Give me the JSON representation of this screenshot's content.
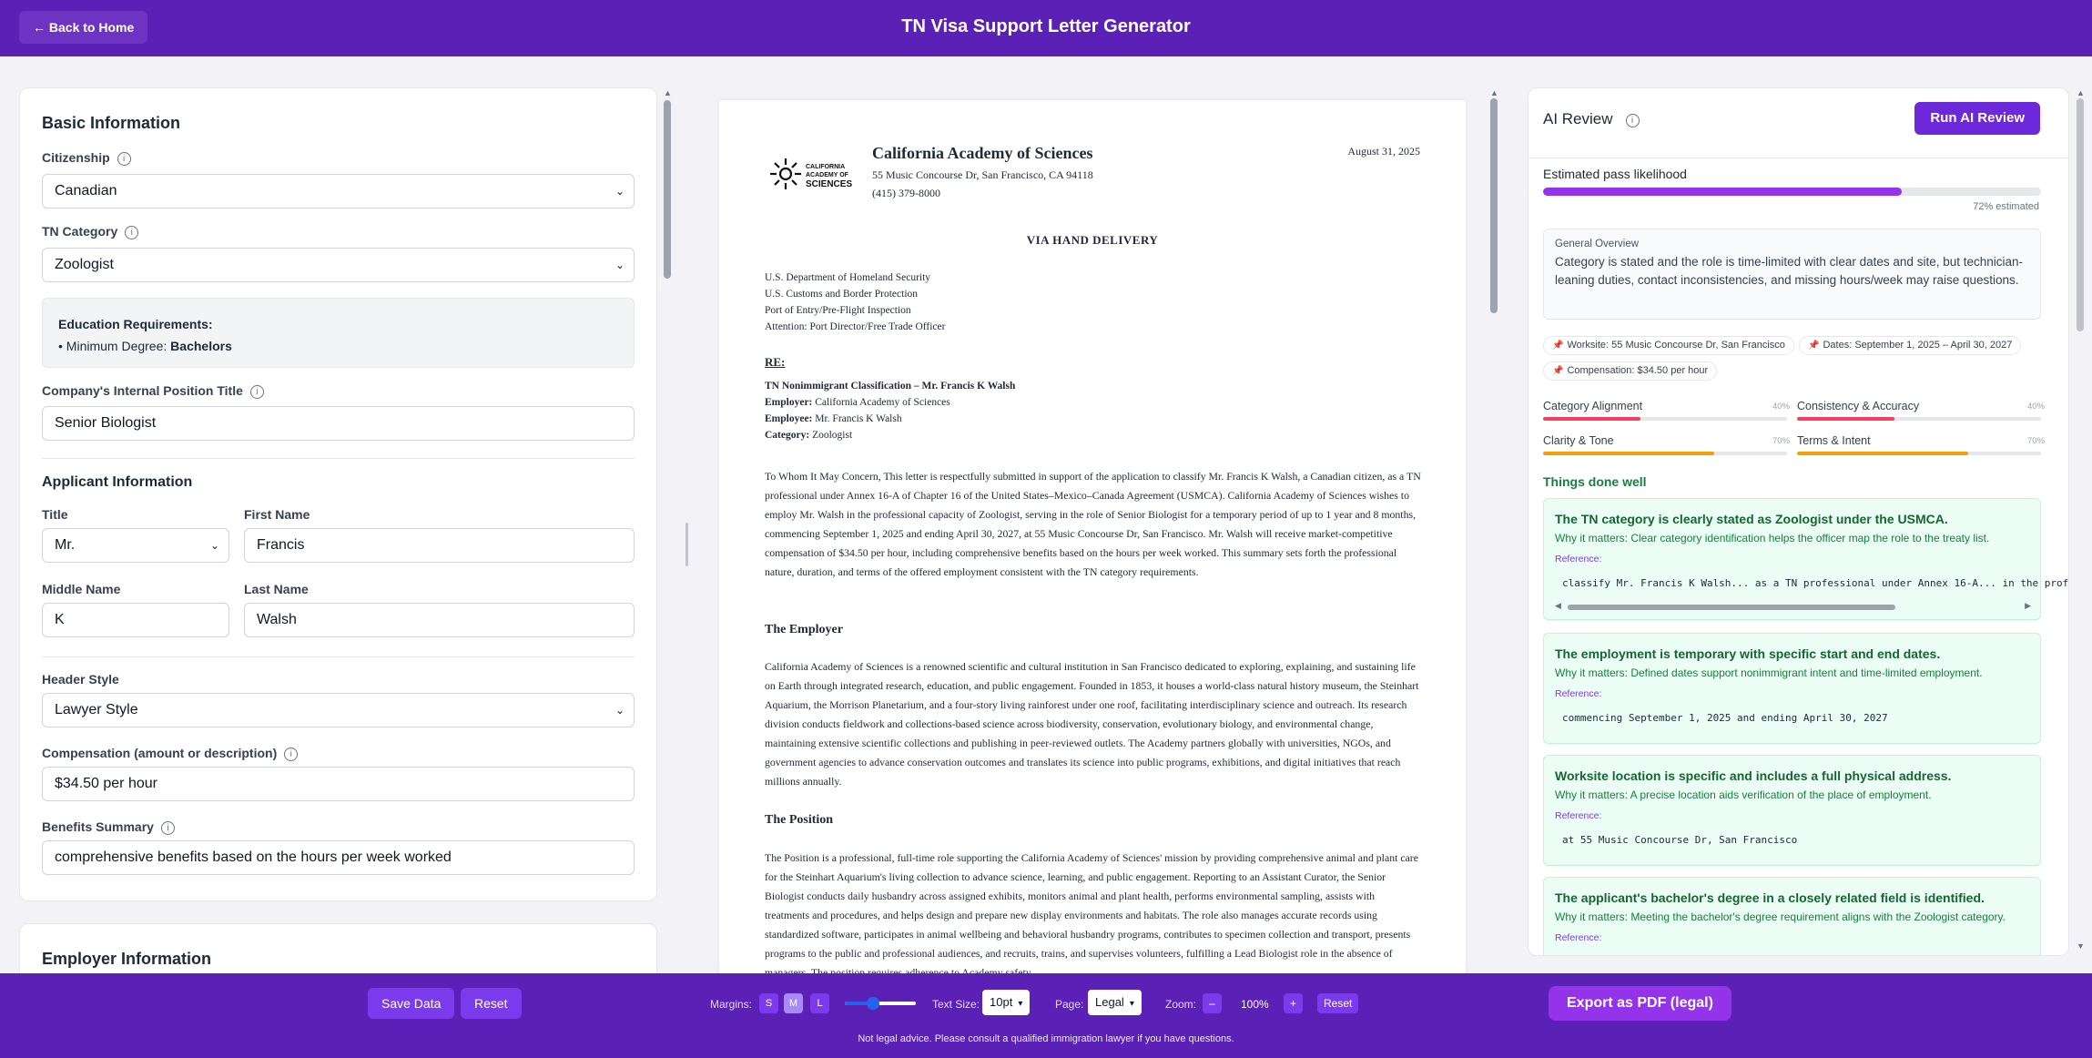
{
  "header": {
    "back_label": "← Back to Home",
    "title": "TN Visa Support Letter Generator"
  },
  "form": {
    "basic_title": "Basic Information",
    "citizenship": {
      "label": "Citizenship",
      "value": "Canadian"
    },
    "tn_category": {
      "label": "TN Category",
      "value": "Zoologist"
    },
    "education": {
      "title": "Education Requirements:",
      "item_prefix": "• Minimum Degree:",
      "degree": "Bachelors"
    },
    "position_title": {
      "label": "Company's Internal Position Title",
      "value": "Senior Biologist"
    },
    "applicant_title": "Applicant Information",
    "title": {
      "label": "Title",
      "value": "Mr."
    },
    "first_name": {
      "label": "First Name",
      "value": "Francis"
    },
    "middle_name": {
      "label": "Middle Name",
      "value": "K"
    },
    "last_name": {
      "label": "Last Name",
      "value": "Walsh"
    },
    "header_style": {
      "label": "Header Style",
      "value": "Lawyer Style"
    },
    "compensation": {
      "label": "Compensation (amount or description)",
      "value": "$34.50 per hour"
    },
    "benefits": {
      "label": "Benefits Summary",
      "value": "comprehensive benefits based on the hours per week worked"
    },
    "employer_title": "Employer Information"
  },
  "letter": {
    "logo_text": [
      "CALIFORNIA",
      "ACADEMY OF",
      "SCIENCES"
    ],
    "org_name": "California Academy of Sciences",
    "org_address": "55 Music Concourse Dr, San Francisco, CA 94118",
    "org_phone": "(415) 379-8000",
    "date": "August 31, 2025",
    "delivery": "VIA HAND DELIVERY",
    "recipient": [
      "U.S. Department of Homeland Security",
      "U.S. Customs and Border Protection",
      "Port of Entry/Pre-Flight Inspection",
      "Attention: Port Director/Free Trade Officer"
    ],
    "re_label": "RE:",
    "re_heading": "TN Nonimmigrant Classification – Mr. Francis K Walsh",
    "re_employer_label": "Employer:",
    "re_employer": "California Academy of Sciences",
    "re_employee_label": "Employee:",
    "re_employee": "Mr. Francis K Walsh",
    "re_category_label": "Category:",
    "re_category": "Zoologist",
    "intro": "To Whom It May Concern, This letter is respectfully submitted in support of the application to classify Mr. Francis K Walsh, a Canadian citizen, as a TN professional under Annex 16-A of Chapter 16 of the United States–Mexico–Canada Agreement (USMCA). California Academy of Sciences wishes to employ Mr. Walsh in the professional capacity of Zoologist, serving in the role of Senior Biologist for a temporary period of up to 1 year and 8 months, commencing September 1, 2025 and ending April 30, 2027, at 55 Music Concourse Dr, San Francisco. Mr. Walsh will receive market-competitive compensation of $34.50 per hour, including comprehensive benefits based on the hours per week worked. This summary sets forth the professional nature, duration, and terms of the offered employment consistent with the TN category requirements.",
    "employer_heading": "The Employer",
    "employer_text": "California Academy of Sciences is a renowned scientific and cultural institution in San Francisco dedicated to exploring, explaining, and sustaining life on Earth through integrated research, education, and public engagement. Founded in 1853, it houses a world-class natural history museum, the Steinhart Aquarium, the Morrison Planetarium, and a four-story living rainforest under one roof, facilitating interdisciplinary science and outreach. Its research division conducts fieldwork and collections-based science across biodiversity, conservation, evolutionary biology, and environmental change, maintaining extensive scientific collections and publishing in peer-reviewed outlets. The Academy partners globally with universities, NGOs, and government agencies to advance conservation outcomes and translates its science into public programs, exhibitions, and digital initiatives that reach millions annually.",
    "position_heading": "The Position",
    "position_text": "The Position is a professional, full-time role supporting the California Academy of Sciences' mission by providing comprehensive animal and plant care for the Steinhart Aquarium's living collection to advance science, learning, and public engagement. Reporting to an Assistant Curator, the Senior Biologist conducts daily husbandry across assigned exhibits, monitors animal and plant health, performs environmental sampling, assists with treatments and procedures, and helps design and prepare new display environments and habitats. The role also manages accurate records using standardized software, participates in animal wellbeing and behavioral husbandry programs, contributes to specimen collection and transport, presents programs to the public and professional audiences, and recruits, trains, and supervises volunteers, fulfilling a Lead Biologist role in the absence of managers. The position requires adherence to Academy safety"
  },
  "review": {
    "title": "AI Review",
    "run_label": "Run AI Review",
    "pass_label": "Estimated pass likelihood",
    "pass_value": 72,
    "pass_note": "72% estimated",
    "overview_title": "General Overview",
    "overview_text": "Category is stated and the role is time-limited with clear dates and site, but technician-leaning duties, contact inconsistencies, and missing hours/week may raise questions.",
    "chips": [
      {
        "label": "Worksite:",
        "value": "55 Music Concourse Dr, San Francisco"
      },
      {
        "label": "Dates:",
        "value": "September 1, 2025 – April 30, 2027"
      },
      {
        "label": "Compensation:",
        "value": "$34.50 per hour"
      }
    ],
    "metrics": [
      {
        "label": "Category Alignment",
        "pct": "40%",
        "value": 40,
        "color": "#f43f5e"
      },
      {
        "label": "Consistency & Accuracy",
        "pct": "40%",
        "value": 40,
        "color": "#f43f5e"
      },
      {
        "label": "Clarity & Tone",
        "pct": "70%",
        "value": 70,
        "color": "#f59e0b"
      },
      {
        "label": "Terms & Intent",
        "pct": "70%",
        "value": 70,
        "color": "#f59e0b"
      }
    ],
    "done_title": "Things done well",
    "ref_label": "Reference:",
    "items": [
      {
        "title": "The TN category is clearly stated as Zoologist under the USMCA.",
        "why": "Why it matters: Clear category identification helps the officer map the role to the treaty list.",
        "code": "classify Mr. Francis K Walsh... as a TN professional under Annex 16-A... in the profe"
      },
      {
        "title": "The employment is temporary with specific start and end dates.",
        "why": "Why it matters: Defined dates support nonimmigrant intent and time-limited employment.",
        "code": "commencing September 1, 2025 and ending April 30, 2027"
      },
      {
        "title": "Worksite location is specific and includes a full physical address.",
        "why": "Why it matters: A precise location aids verification of the place of employment.",
        "code": "at 55 Music Concourse Dr, San Francisco"
      },
      {
        "title": "The applicant's bachelor's degree in a closely related field is identified.",
        "why": "Why it matters: Meeting the bachelor's degree requirement aligns with the Zoologist category.",
        "code": ""
      }
    ]
  },
  "footer": {
    "save_label": "Save Data",
    "reset_label": "Reset",
    "margins_label": "Margins:",
    "margin_options": [
      "S",
      "M",
      "L"
    ],
    "text_size_label": "Text Size:",
    "text_size_value": "10pt",
    "page_label": "Page:",
    "page_value": "Legal",
    "zoom_label": "Zoom:",
    "zoom_minus": "–",
    "zoom_value": "100%",
    "zoom_plus": "+",
    "zoom_reset": "Reset",
    "export_label": "Export as PDF (legal)",
    "disclaimer": "Not legal advice. Please consult a qualified immigration lawyer if you have questions."
  }
}
